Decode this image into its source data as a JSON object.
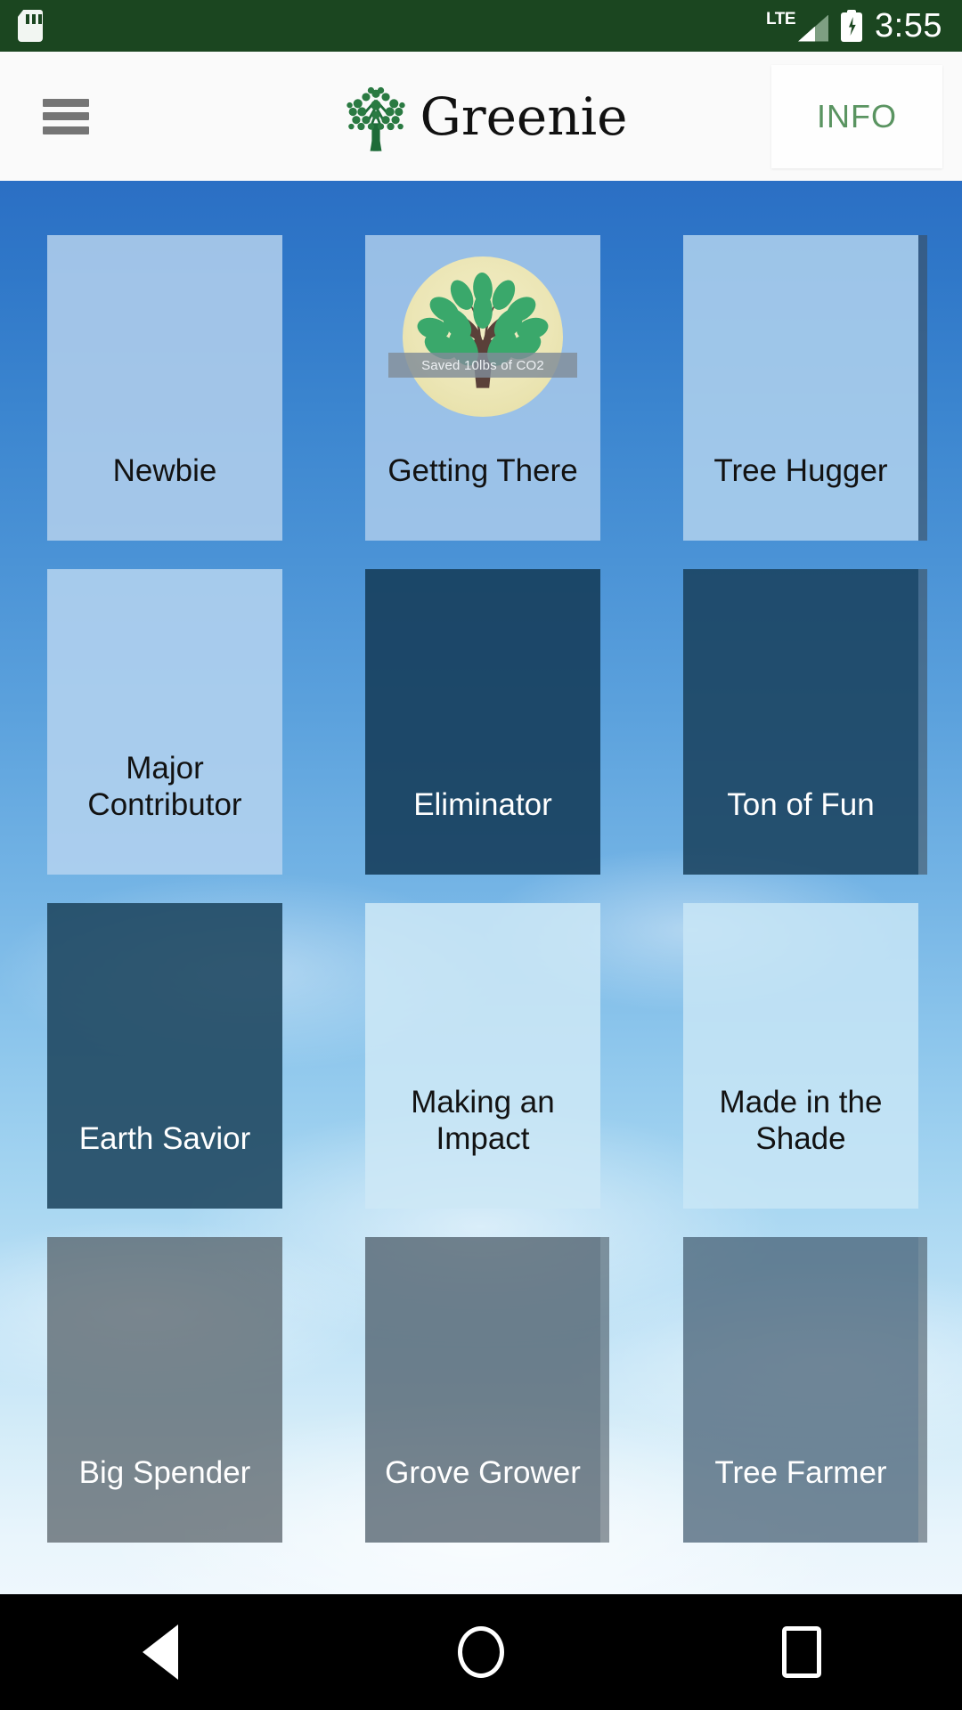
{
  "status_bar": {
    "sd_card_icon": "sd-card-icon",
    "network_label": "LTE",
    "signal_icon": "signal-bars-icon",
    "battery_icon": "battery-charging-icon",
    "time": "3:55",
    "background_color": "#1b4620"
  },
  "header": {
    "menu_icon": "hamburger-menu-icon",
    "logo_icon": "tree-logo-icon",
    "app_title": "Greenie",
    "info_button_label": "INFO",
    "info_button_color": "#5a9461",
    "background_color": "#fafafa"
  },
  "achievements": {
    "columns": 3,
    "items": [
      {
        "title": "Newbie",
        "theme": "light",
        "badge": null
      },
      {
        "title": "Getting There",
        "theme": "light",
        "badge": {
          "icon": "tree-badge-icon",
          "caption": "Saved 10lbs of CO2"
        }
      },
      {
        "title": "Tree Hugger",
        "theme": "light",
        "badge": null
      },
      {
        "title": "Major\nContributor",
        "theme": "light",
        "badge": null
      },
      {
        "title": "Eliminator",
        "theme": "dark",
        "badge": null
      },
      {
        "title": "Ton of Fun",
        "theme": "dark",
        "badge": null
      },
      {
        "title": "Earth Savior",
        "theme": "dark",
        "badge": null
      },
      {
        "title": "Making an\nImpact",
        "theme": "light",
        "badge": null
      },
      {
        "title": "Made in the\nShade",
        "theme": "light",
        "badge": null
      },
      {
        "title": "Big Spender",
        "theme": "dark",
        "badge": null
      },
      {
        "title": "Grove Grower",
        "theme": "dark",
        "badge": null
      },
      {
        "title": "Tree Farmer",
        "theme": "dark",
        "badge": null
      }
    ]
  },
  "nav_bar": {
    "back_icon": "back-triangle-icon",
    "home_icon": "home-circle-icon",
    "recents_icon": "recents-square-icon",
    "background_color": "#000000"
  }
}
